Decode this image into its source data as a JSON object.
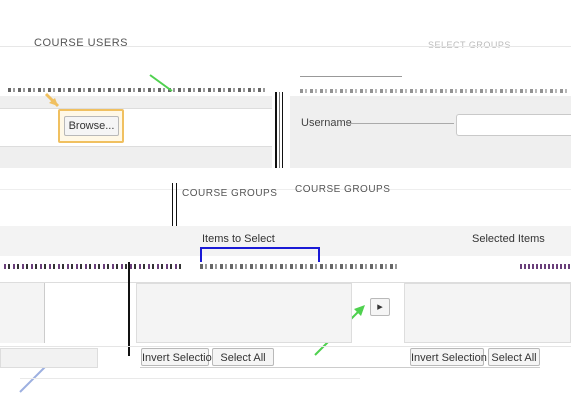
{
  "sections": {
    "course_users": "COURSE USERS",
    "course_groups": "COURSE GROUPS",
    "top_right_faded": "SELECT GROUPS"
  },
  "upload": {
    "browse_label": "Browse..."
  },
  "username": {
    "label": "Username",
    "value": ""
  },
  "transfer": {
    "items_to_select": "Items to Select",
    "selected_items": "Selected Items",
    "move_right_symbol": "▸",
    "left": {
      "invert_label": "Invert Selection",
      "select_all_label": "Select All"
    },
    "right": {
      "invert_label": "Invert Selection",
      "select_all_label": "Select All"
    }
  },
  "colors": {
    "highlight_orange": "#f0c060",
    "callout_green": "#4fd14f",
    "accent_blue": "#1a1ad6",
    "panel_gray": "#efefef"
  }
}
